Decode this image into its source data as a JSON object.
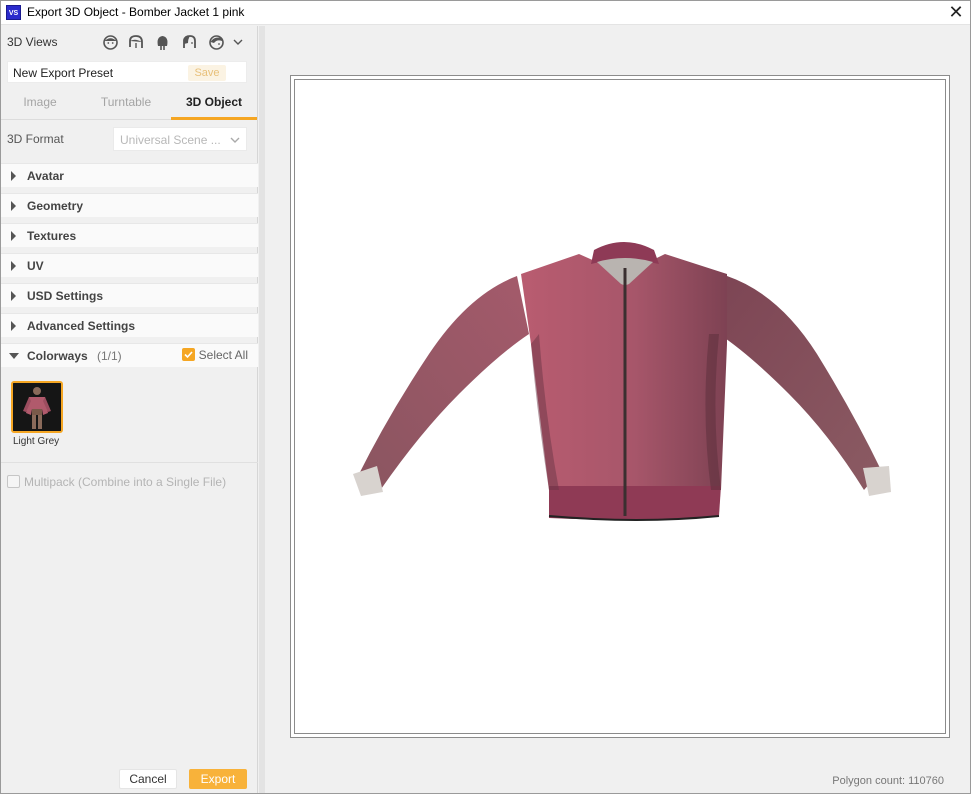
{
  "window": {
    "app_icon_text": "VS",
    "title": "Export 3D Object - Bomber Jacket 1 pink",
    "close_glyph": "✕"
  },
  "sidebar": {
    "views_label": "3D Views",
    "view_icons": [
      "avatar-front-view-icon",
      "avatar-side-view-icon",
      "avatar-back-view-icon",
      "avatar-left-view-icon",
      "avatar-right-view-icon"
    ],
    "preset": {
      "value": "New Export Preset",
      "save_label": "Save"
    },
    "tabs": [
      {
        "label": "Image",
        "active": false
      },
      {
        "label": "Turntable",
        "active": false
      },
      {
        "label": "3D Object",
        "active": true
      }
    ],
    "format": {
      "label": "3D Format",
      "value": "Universal Scene ..."
    },
    "sections": [
      {
        "label": "Avatar",
        "expanded": false
      },
      {
        "label": "Geometry",
        "expanded": false
      },
      {
        "label": "Textures",
        "expanded": false
      },
      {
        "label": "UV",
        "expanded": false
      },
      {
        "label": "USD Settings",
        "expanded": false
      },
      {
        "label": "Advanced Settings",
        "expanded": false
      },
      {
        "label": "Colorways",
        "expanded": true,
        "count": "(1/1)"
      }
    ],
    "select_all": {
      "label": "Select All",
      "checked": true
    },
    "colorways": [
      {
        "label": "Light Grey",
        "selected": true
      }
    ],
    "multipack": {
      "label": "Multipack (Combine into a Single File)",
      "checked": false,
      "enabled": false
    },
    "buttons": {
      "cancel": "Cancel",
      "export": "Export"
    }
  },
  "preview": {
    "polygon_count": "Polygon count: 110760",
    "garment_color": "#b15a6c"
  },
  "colors": {
    "accent": "#f5a623",
    "export_button": "#f8b23a"
  }
}
